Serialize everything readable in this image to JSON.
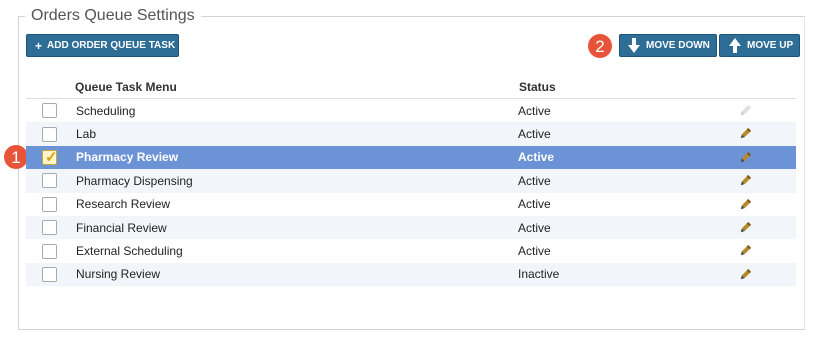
{
  "panel": {
    "title": "Orders Queue Settings"
  },
  "toolbar": {
    "add_label": "ADD ORDER QUEUE TASK",
    "add_icon": "plus",
    "move_down_label": "MOVE DOWN",
    "move_up_label": "MOVE UP",
    "button_color": "#2d6d96"
  },
  "callouts": {
    "first": "1",
    "second": "2",
    "color": "#e8543a"
  },
  "table": {
    "columns": {
      "task": "Queue Task Menu",
      "status": "Status"
    },
    "selected_row_color": "#6b93d6",
    "rows": [
      {
        "task": "Scheduling",
        "status": "Active",
        "checked": false
      },
      {
        "task": "Lab",
        "status": "Active",
        "checked": false
      },
      {
        "task": "Pharmacy Review",
        "status": "Active",
        "checked": true
      },
      {
        "task": "Pharmacy Dispensing",
        "status": "Active",
        "checked": false
      },
      {
        "task": "Research Review",
        "status": "Active",
        "checked": false
      },
      {
        "task": "Financial Review",
        "status": "Active",
        "checked": false
      },
      {
        "task": "External Scheduling",
        "status": "Active",
        "checked": false
      },
      {
        "task": "Nursing Review",
        "status": "Inactive",
        "checked": false
      }
    ]
  }
}
